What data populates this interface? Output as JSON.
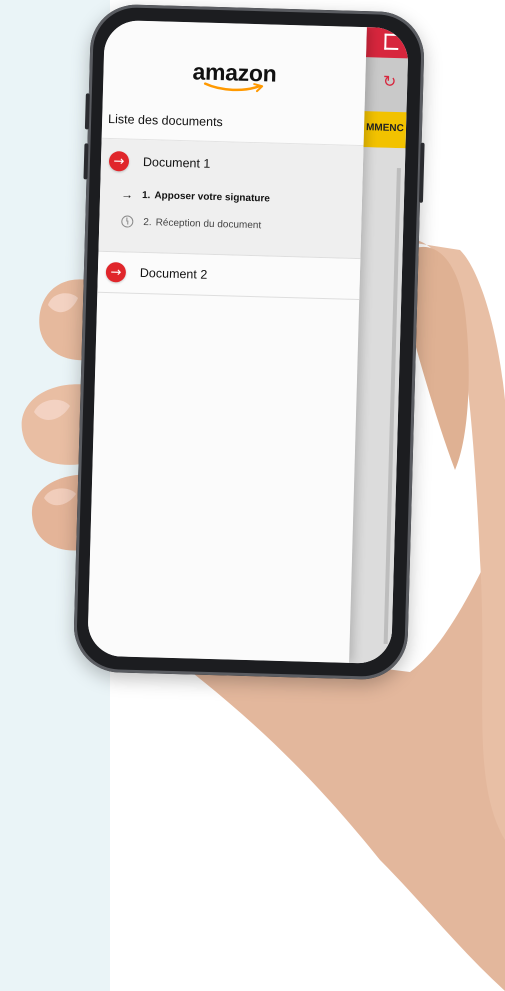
{
  "brand": {
    "logo_text": "amazon",
    "accent": "#ff9900"
  },
  "drawer": {
    "title": "Liste des documents",
    "documents": [
      {
        "label": "Document 1",
        "icon": "arrow-right-circle-icon",
        "expanded": true,
        "steps": [
          {
            "number": "1.",
            "label": "Apposer votre signature",
            "status": "current",
            "icon": "arrow-right-icon"
          },
          {
            "number": "2.",
            "label": "Réception du document",
            "status": "pending",
            "icon": "clock-icon"
          }
        ]
      },
      {
        "label": "Document 2",
        "icon": "arrow-right-circle-icon",
        "expanded": false
      }
    ]
  },
  "background_app": {
    "strip_text": "MMENC",
    "colors": {
      "topbar": "#d7263d",
      "strip": "#f2c200"
    },
    "icons": [
      "exit-icon",
      "sync-icon"
    ]
  }
}
